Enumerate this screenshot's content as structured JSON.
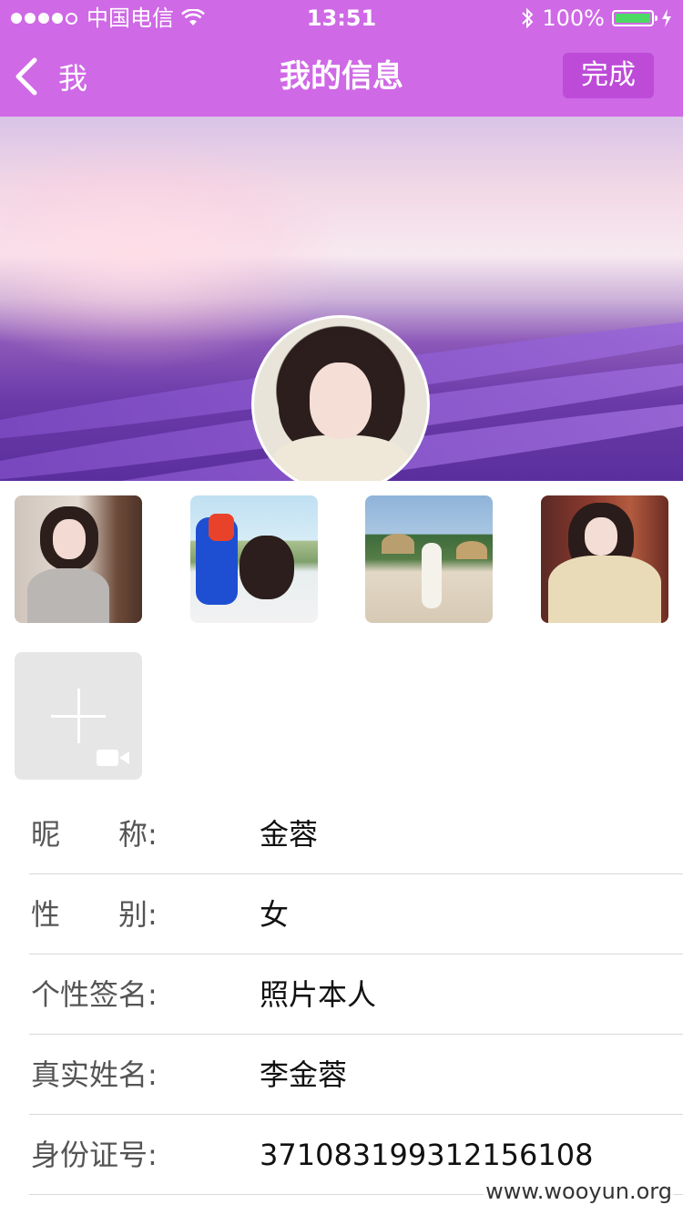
{
  "status_bar": {
    "carrier": "中国电信",
    "time": "13:51",
    "battery": "100%"
  },
  "nav": {
    "back_label": "我",
    "title": "我的信息",
    "done_label": "完成"
  },
  "profile_fields": [
    {
      "label": "昵　　称:",
      "value": "金蓉"
    },
    {
      "label": "性　　别:",
      "value": "女"
    },
    {
      "label": "个性签名:",
      "value": "照片本人"
    },
    {
      "label": "真实姓名:",
      "value": "李金蓉"
    },
    {
      "label": "身份证号:",
      "value": "371083199312156108"
    }
  ],
  "watermark": "www.wooyun.org",
  "colors": {
    "header_bg": "#cf69e6",
    "done_button_bg": "#bd4bd8",
    "battery_fill": "#4cd964"
  }
}
